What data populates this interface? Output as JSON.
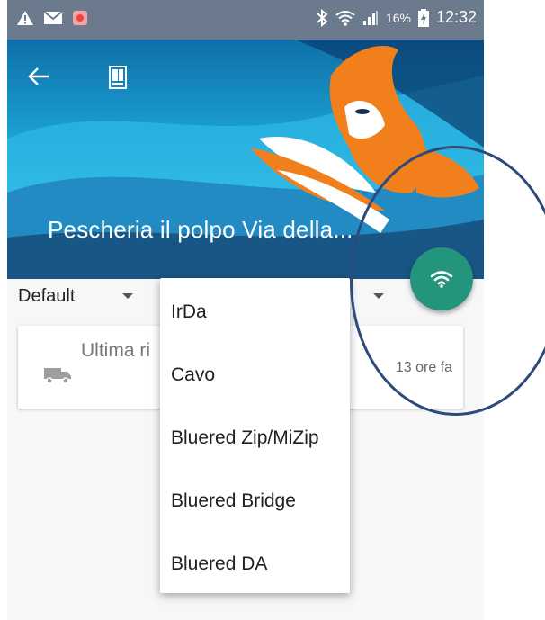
{
  "status_bar": {
    "battery": "16%",
    "time": "12:32"
  },
  "header": {
    "title": "Pescheria il polpo Via della..."
  },
  "filter": {
    "selected": "Default"
  },
  "card": {
    "title": "Ultima ri",
    "time": "13 ore fa"
  },
  "dropdown_menu": {
    "items": [
      "IrDa",
      "Cavo",
      "Bluered Zip/MiZip",
      "Bluered Bridge",
      "Bluered DA"
    ]
  },
  "colors": {
    "status_bar": "#6b7a8c",
    "fab": "#22957c",
    "fox_orange": "#f07f1c",
    "annotation_circle": "#2e4a7a"
  }
}
